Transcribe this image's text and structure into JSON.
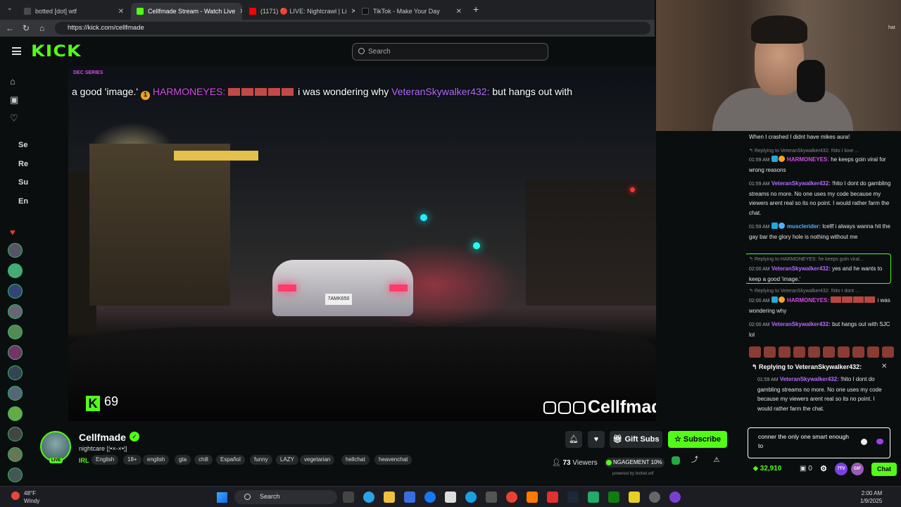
{
  "browser": {
    "tabs": [
      {
        "label": "botted [dot] wtf",
        "fav": "#4a4a4a"
      },
      {
        "label": "Cellfmade Stream - Watch Live",
        "fav": "#53fc18",
        "active": true
      },
      {
        "label": "(1171) 🔴 LIVE: Nightcrawl | Li",
        "fav": "#ff0000"
      },
      {
        "label": "TikTok - Make Your Day",
        "fav": "#111111"
      }
    ],
    "new_tab": "+",
    "url": "https://kick.com/cellfmade"
  },
  "kick": {
    "logo": "KICK",
    "search_placeholder": "Search"
  },
  "rail": {
    "labels": [
      "Se",
      "Re",
      "Su",
      "En"
    ]
  },
  "video": {
    "tag_top": "DEC SERIES",
    "overlay": {
      "part1": "a good 'image.'",
      "user1": "HARMONEYES:",
      "part2": "i was wondering why",
      "user2": "VeteranSkywalker432:",
      "part3": "but hangs out with"
    },
    "kick_count": "69",
    "watermark": "Cellfmade",
    "plate": "7AMK650"
  },
  "streamer": {
    "name": "Cellfmade",
    "live": "LIVE",
    "title": "nightcare |¦•×-×•¦|",
    "category": "IRL",
    "tags": [
      "English",
      "18+",
      "english",
      "gta",
      "chill",
      "Español",
      "funny",
      "LAZY",
      "vegetarian",
      "hellchat",
      "heavenchat"
    ],
    "gift_label": "Gift Subs",
    "subscribe_label": "Subscribe",
    "viewers_count": "73",
    "viewers_label": "Viewers",
    "engagement": "NGAGEMENT 10%",
    "powered": "powered by botted.wtf"
  },
  "webcam": {
    "corner_text": "hat"
  },
  "chat": {
    "top_line": "When I crashed I didnt have mikes aura!",
    "messages": [
      {
        "reply": "Replying to VeteranSkywalker432: !hito I love ...",
        "time": "01:59 AM",
        "user": "HARMONEYES:",
        "text": "he keeps goin viral for wrong reasons"
      },
      {
        "time": "01:59 AM",
        "user": "VeteranSkywalker432:",
        "text": "!hito I dont do gambling streams no more. No one uses my code because my viewers arent real so its no point. I would rather farm the chat."
      },
      {
        "time": "01:59 AM",
        "user": "musclerider:",
        "text": "lcellf i always wanna hit the gay bar the glory hole is nothing without me"
      },
      {
        "reply": "Replying to HARMONEYES: he keeps goin viral...",
        "time": "02:00 AM",
        "user": "VeteranSkywalker432:",
        "text": "yes and he wants to keep a good 'image.'"
      },
      {
        "reply": "Replying to VeteranSkywalker432: !hito I dont ...",
        "time": "02:00 AM",
        "user": "HARMONEYES:",
        "text": "i was wondering why"
      },
      {
        "time": "02:00 AM",
        "user": "VeteranSkywalker432:",
        "text": "but hangs out with SJC lol"
      }
    ],
    "replying": {
      "header": "Replying to VeteranSkywalker432:",
      "time": "01:59 AM",
      "user": "VeteranSkywalker432:",
      "text": "!hito I dont do gambling streams no more. No one uses my code because my viewers arent real so its no point. I would rather farm the chat."
    },
    "input_value": "conner the only one smart enough to",
    "points": "32,910",
    "gift_count": "0",
    "chat_button": "Chat"
  },
  "taskbar": {
    "temp": "48°F",
    "weather": "Windy",
    "search": "Search",
    "time": "2:00 AM",
    "date": "1/9/2025"
  }
}
